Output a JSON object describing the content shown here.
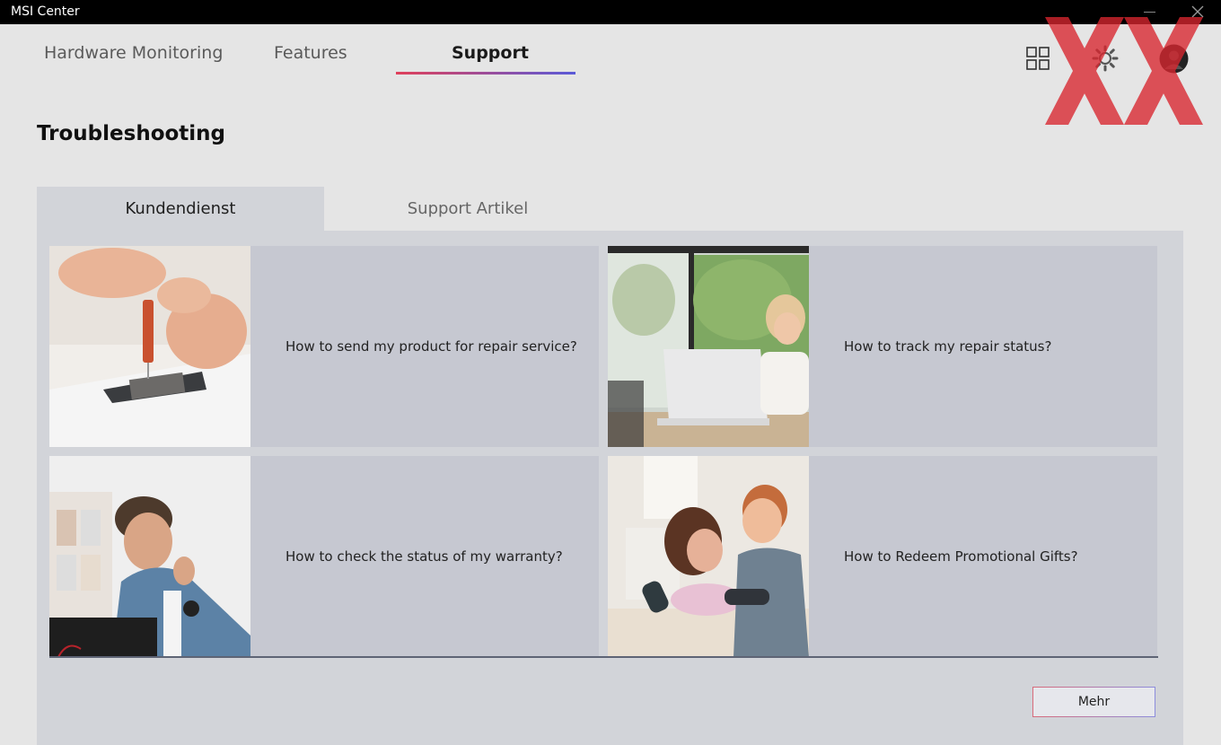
{
  "window": {
    "title": "MSI Center"
  },
  "nav": {
    "tabs": [
      {
        "label": "Hardware Monitoring"
      },
      {
        "label": "Features"
      },
      {
        "label": "Support"
      }
    ],
    "active_tab": "Support"
  },
  "page": {
    "title": "Troubleshooting"
  },
  "subtabs": [
    {
      "label": "Kundendienst"
    },
    {
      "label": "Support Artikel"
    }
  ],
  "cards": [
    {
      "label": "How to send my product for repair service?",
      "image": "repair-photo"
    },
    {
      "label": "How to track my repair status?",
      "image": "woman-laptop-phone-photo"
    },
    {
      "label": "How to check the status of my warranty?",
      "image": "man-repair-photo"
    },
    {
      "label": "How to Redeem Promotional Gifts?",
      "image": "couple-gaming-photo"
    }
  ],
  "footer": {
    "more_button": "Mehr"
  },
  "colors": {
    "accent_start": "#e0405a",
    "accent_end": "#5a5ad8",
    "card_bg": "#c6c8d1",
    "panel_bg": "#d2d4d9"
  }
}
